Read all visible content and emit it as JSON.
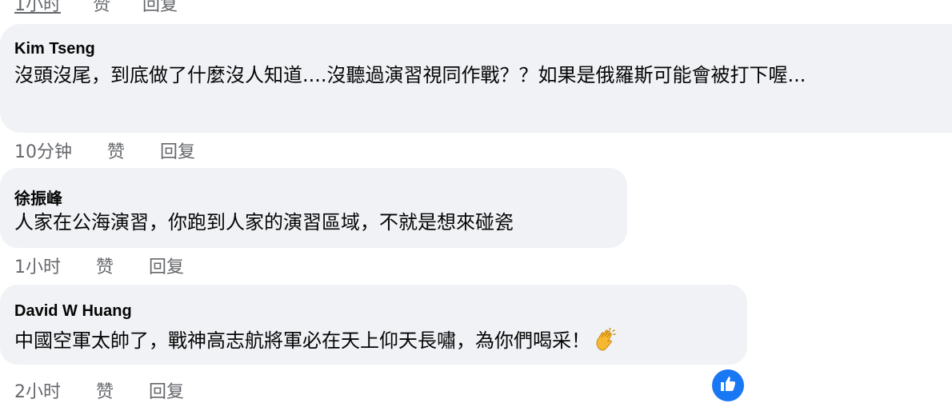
{
  "top_actions": {
    "time": "1小时",
    "like": "赞",
    "reply": "回复"
  },
  "comments": [
    {
      "author": "Kim Tseng",
      "text": "沒頭沒尾，到底做了什麼沒人知道....沒聽過演習視同作戰？？如果是俄羅斯可能會被打下喔...",
      "time": "10分钟",
      "like": "赞",
      "reply": "回复"
    },
    {
      "author": "徐振峰",
      "text": "人家在公海演習，你跑到人家的演習區域，不就是想來碰瓷",
      "time": "1小时",
      "like": "赞",
      "reply": "回复"
    },
    {
      "author": "David W Huang",
      "text": "中國空軍太帥了，戰神高志航將軍必在天上仰天長嘯，為你們喝采！",
      "emoji": "clapping-hands-icon",
      "time": "2小时",
      "like": "赞",
      "reply": "回复"
    }
  ],
  "colors": {
    "bubble": "#f0f2f5",
    "meta": "#65676b",
    "text": "#050505",
    "accent": "#1877f2"
  }
}
